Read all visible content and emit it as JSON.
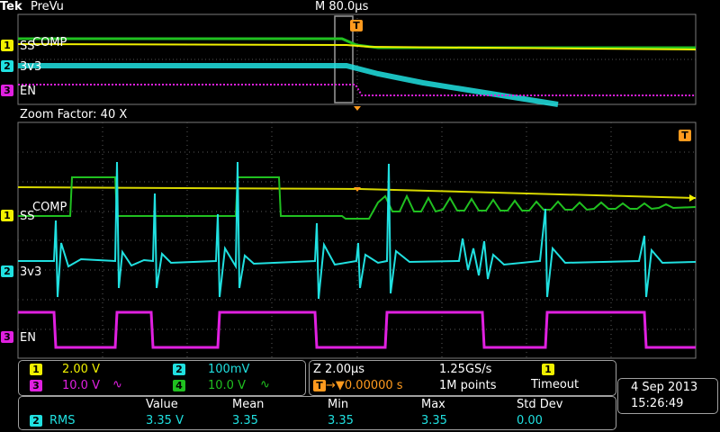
{
  "header": {
    "brand": "Tek",
    "mode": "PreVu",
    "timebase": "M 80.0µs",
    "trigger_marker": "T"
  },
  "overview": {
    "channels": [
      {
        "num": "1",
        "label": "SS",
        "label2": "COMP"
      },
      {
        "num": "2",
        "label": "3v3"
      },
      {
        "num": "3",
        "label": "EN"
      }
    ]
  },
  "zoom": {
    "title": "Zoom Factor: 40 X",
    "trigger_marker": "T",
    "channels": [
      {
        "num": "1",
        "label": "SS",
        "label2": "COMP"
      },
      {
        "num": "2",
        "label": "3v3"
      },
      {
        "num": "3",
        "label": "EN"
      }
    ]
  },
  "scales": {
    "ch1": {
      "num": "1",
      "value": "2.00 V"
    },
    "ch2": {
      "num": "2",
      "value": "100mV"
    },
    "ch3": {
      "num": "3",
      "value": "10.0 V",
      "bw": "∿"
    },
    "ch4": {
      "num": "4",
      "value": "10.0 V",
      "bw": "∿"
    }
  },
  "acquisition": {
    "zoom_time": "Z 2.00µs",
    "sample_rate": "1.25GS/s",
    "trigger_badge": "1",
    "trigger_marker": "T",
    "trigger_pos": "→▼0.00000 s",
    "record_length": "1M points",
    "trigger_status": "Timeout"
  },
  "datetime": {
    "date": "4 Sep  2013",
    "time": "15:26:49"
  },
  "measurements": {
    "headers": [
      "Value",
      "Mean",
      "Min",
      "Max",
      "Std Dev"
    ],
    "rows": [
      {
        "channel": "2",
        "type": "RMS",
        "values": [
          "3.35 V",
          "3.35",
          "3.35",
          "3.35",
          "0.00"
        ]
      }
    ]
  },
  "colors": {
    "ch1": "#f0f000",
    "ch2": "#20e0e0",
    "ch3": "#e020e0",
    "ch4": "#20c020",
    "trigger": "#ff9a1e",
    "grid": "#7a7a7a"
  }
}
